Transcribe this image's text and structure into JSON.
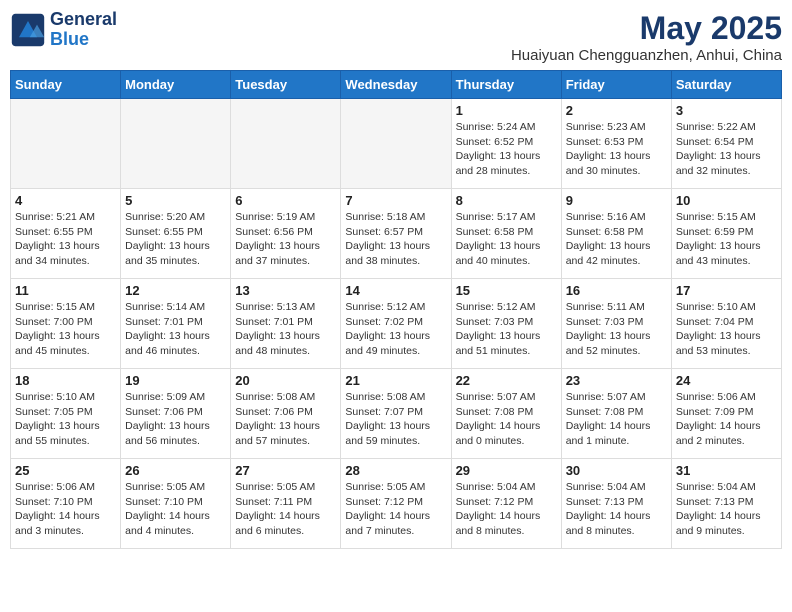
{
  "logo": {
    "line1": "General",
    "line2": "Blue"
  },
  "title": "May 2025",
  "subtitle": "Huaiyuan Chengguanzhen, Anhui, China",
  "days_of_week": [
    "Sunday",
    "Monday",
    "Tuesday",
    "Wednesday",
    "Thursday",
    "Friday",
    "Saturday"
  ],
  "weeks": [
    [
      {
        "num": "",
        "info": ""
      },
      {
        "num": "",
        "info": ""
      },
      {
        "num": "",
        "info": ""
      },
      {
        "num": "",
        "info": ""
      },
      {
        "num": "1",
        "info": "Sunrise: 5:24 AM\nSunset: 6:52 PM\nDaylight: 13 hours\nand 28 minutes."
      },
      {
        "num": "2",
        "info": "Sunrise: 5:23 AM\nSunset: 6:53 PM\nDaylight: 13 hours\nand 30 minutes."
      },
      {
        "num": "3",
        "info": "Sunrise: 5:22 AM\nSunset: 6:54 PM\nDaylight: 13 hours\nand 32 minutes."
      }
    ],
    [
      {
        "num": "4",
        "info": "Sunrise: 5:21 AM\nSunset: 6:55 PM\nDaylight: 13 hours\nand 34 minutes."
      },
      {
        "num": "5",
        "info": "Sunrise: 5:20 AM\nSunset: 6:55 PM\nDaylight: 13 hours\nand 35 minutes."
      },
      {
        "num": "6",
        "info": "Sunrise: 5:19 AM\nSunset: 6:56 PM\nDaylight: 13 hours\nand 37 minutes."
      },
      {
        "num": "7",
        "info": "Sunrise: 5:18 AM\nSunset: 6:57 PM\nDaylight: 13 hours\nand 38 minutes."
      },
      {
        "num": "8",
        "info": "Sunrise: 5:17 AM\nSunset: 6:58 PM\nDaylight: 13 hours\nand 40 minutes."
      },
      {
        "num": "9",
        "info": "Sunrise: 5:16 AM\nSunset: 6:58 PM\nDaylight: 13 hours\nand 42 minutes."
      },
      {
        "num": "10",
        "info": "Sunrise: 5:15 AM\nSunset: 6:59 PM\nDaylight: 13 hours\nand 43 minutes."
      }
    ],
    [
      {
        "num": "11",
        "info": "Sunrise: 5:15 AM\nSunset: 7:00 PM\nDaylight: 13 hours\nand 45 minutes."
      },
      {
        "num": "12",
        "info": "Sunrise: 5:14 AM\nSunset: 7:01 PM\nDaylight: 13 hours\nand 46 minutes."
      },
      {
        "num": "13",
        "info": "Sunrise: 5:13 AM\nSunset: 7:01 PM\nDaylight: 13 hours\nand 48 minutes."
      },
      {
        "num": "14",
        "info": "Sunrise: 5:12 AM\nSunset: 7:02 PM\nDaylight: 13 hours\nand 49 minutes."
      },
      {
        "num": "15",
        "info": "Sunrise: 5:12 AM\nSunset: 7:03 PM\nDaylight: 13 hours\nand 51 minutes."
      },
      {
        "num": "16",
        "info": "Sunrise: 5:11 AM\nSunset: 7:03 PM\nDaylight: 13 hours\nand 52 minutes."
      },
      {
        "num": "17",
        "info": "Sunrise: 5:10 AM\nSunset: 7:04 PM\nDaylight: 13 hours\nand 53 minutes."
      }
    ],
    [
      {
        "num": "18",
        "info": "Sunrise: 5:10 AM\nSunset: 7:05 PM\nDaylight: 13 hours\nand 55 minutes."
      },
      {
        "num": "19",
        "info": "Sunrise: 5:09 AM\nSunset: 7:06 PM\nDaylight: 13 hours\nand 56 minutes."
      },
      {
        "num": "20",
        "info": "Sunrise: 5:08 AM\nSunset: 7:06 PM\nDaylight: 13 hours\nand 57 minutes."
      },
      {
        "num": "21",
        "info": "Sunrise: 5:08 AM\nSunset: 7:07 PM\nDaylight: 13 hours\nand 59 minutes."
      },
      {
        "num": "22",
        "info": "Sunrise: 5:07 AM\nSunset: 7:08 PM\nDaylight: 14 hours\nand 0 minutes."
      },
      {
        "num": "23",
        "info": "Sunrise: 5:07 AM\nSunset: 7:08 PM\nDaylight: 14 hours\nand 1 minute."
      },
      {
        "num": "24",
        "info": "Sunrise: 5:06 AM\nSunset: 7:09 PM\nDaylight: 14 hours\nand 2 minutes."
      }
    ],
    [
      {
        "num": "25",
        "info": "Sunrise: 5:06 AM\nSunset: 7:10 PM\nDaylight: 14 hours\nand 3 minutes."
      },
      {
        "num": "26",
        "info": "Sunrise: 5:05 AM\nSunset: 7:10 PM\nDaylight: 14 hours\nand 4 minutes."
      },
      {
        "num": "27",
        "info": "Sunrise: 5:05 AM\nSunset: 7:11 PM\nDaylight: 14 hours\nand 6 minutes."
      },
      {
        "num": "28",
        "info": "Sunrise: 5:05 AM\nSunset: 7:12 PM\nDaylight: 14 hours\nand 7 minutes."
      },
      {
        "num": "29",
        "info": "Sunrise: 5:04 AM\nSunset: 7:12 PM\nDaylight: 14 hours\nand 8 minutes."
      },
      {
        "num": "30",
        "info": "Sunrise: 5:04 AM\nSunset: 7:13 PM\nDaylight: 14 hours\nand 8 minutes."
      },
      {
        "num": "31",
        "info": "Sunrise: 5:04 AM\nSunset: 7:13 PM\nDaylight: 14 hours\nand 9 minutes."
      }
    ]
  ]
}
